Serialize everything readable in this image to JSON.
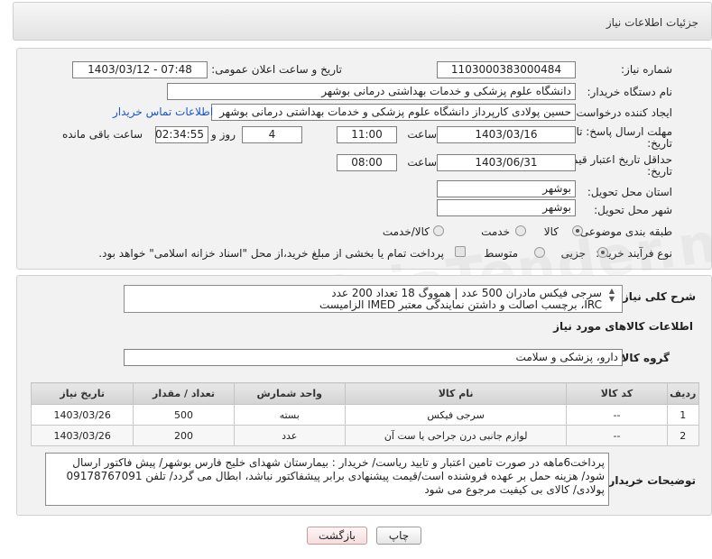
{
  "header": {
    "title": "جزئیات اطلاعات نیاز"
  },
  "form": {
    "need_number_label": "شماره نیاز:",
    "need_number": "1103000383000484",
    "announce_label": "تاریخ و ساعت اعلان عمومی:",
    "announce_value": "1403/03/12 - 07:48",
    "buyer_label": "نام دستگاه خریدار:",
    "buyer_value": "دانشگاه علوم پزشکی و خدمات بهداشتی درمانی بوشهر",
    "creator_label": "ایجاد کننده درخواست:",
    "creator_value": "حسین پولادی کارپرداز دانشگاه علوم پزشکی و خدمات بهداشتی درمانی بوشهر",
    "contact_link": "اطلاعات تماس خریدار",
    "deadline_label_1": "مهلت ارسال پاسخ: تا",
    "deadline_label_2": "تاریخ:",
    "deadline_date": "1403/03/16",
    "time_label": "ساعت",
    "deadline_time": "11:00",
    "days_value": "4",
    "days_label": "روز و",
    "remain_time": "02:34:55",
    "remain_label": "ساعت باقی مانده",
    "validity_label_1": "حداقل تاریخ اعتبار قیمت: تا",
    "validity_label_2": "تاریخ:",
    "validity_date": "1403/06/31",
    "validity_time_label": "ساعت",
    "validity_time": "08:00",
    "province_label": "استان محل تحویل:",
    "province_value": "بوشهر",
    "city_label": "شهر محل تحویل:",
    "city_value": "بوشهر",
    "category_label": "طبقه بندی موضوعی:",
    "category_options": [
      "کالا",
      "خدمت",
      "کالا/خدمت"
    ],
    "process_label": "نوع فرآیند خرید :",
    "process_options": [
      "جزیی",
      "متوسط"
    ],
    "payment_text": "پرداخت تمام یا بخشی از مبلغ خرید،از محل \"اسناد خزانه اسلامی\" خواهد بود."
  },
  "summary": {
    "label": "شرح کلی نیاز:",
    "line1": "سرجی فیکس مادران 500 عدد | همووگ 18 تعداد 200 عدد",
    "line2": "IRC، برچسب اصالت و داشتن نمایندگی معتبر IMED الزامیست"
  },
  "goods": {
    "section_title": "اطلاعات کالاهای مورد نیاز",
    "group_label": "گروه کالا:",
    "group_value": "دارو، پزشکی و سلامت",
    "columns": [
      "ردیف",
      "کد کالا",
      "نام کالا",
      "واحد شمارش",
      "تعداد / مقدار",
      "تاریخ نیاز"
    ],
    "rows": [
      {
        "idx": "1",
        "code": "--",
        "name": "سرجی فیکس",
        "unit": "بسته",
        "qty": "500",
        "date": "1403/03/26"
      },
      {
        "idx": "2",
        "code": "--",
        "name": "لوازم جانبی درن جراحی یا ست آن",
        "unit": "عدد",
        "qty": "200",
        "date": "1403/03/26"
      }
    ]
  },
  "notes": {
    "label": "توضیحات خریدار:",
    "text": "پرداخت6ماهه در صورت تامین اعتبار و تایید ریاست/ خریدار : بیمارستان شهدای خلیج فارس بوشهر/ پیش فاکتور ارسال شود/ هزینه حمل بر عهده فروشنده است/قیمت پیشنهادی برابر پیشفاکتور نباشد، ابطال می گردد/ تلفن 09178767091 پولادی/ کالای بی کیفیت مرجوع می شود"
  },
  "buttons": {
    "print": "چاپ",
    "back": "بازگشت"
  }
}
